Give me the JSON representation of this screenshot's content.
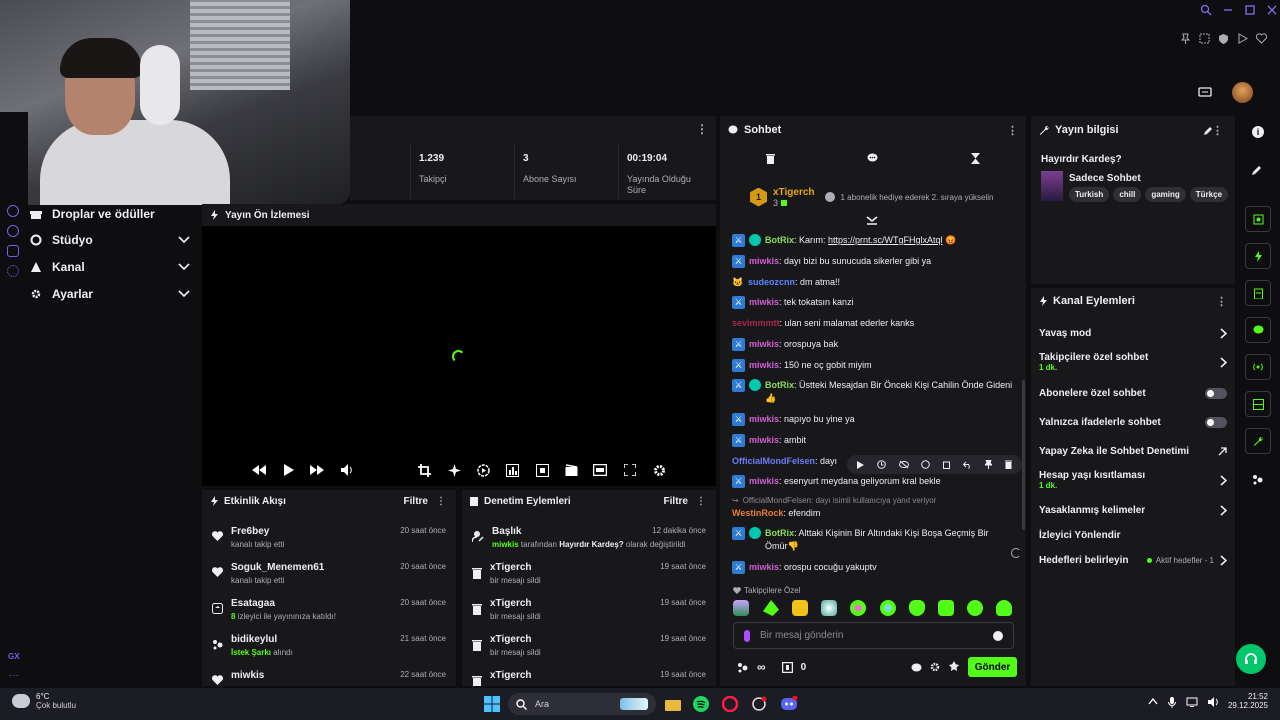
{
  "sidebar": {
    "items": [
      {
        "label": "Droplar ve ödüller",
        "icon": "gift-icon"
      },
      {
        "label": "Stüdyo",
        "icon": "camera-icon"
      },
      {
        "label": "Kanal",
        "icon": "channel-icon"
      },
      {
        "label": "Ayarlar",
        "icon": "gear-icon"
      }
    ],
    "bottom_label": "GX"
  },
  "stats": [
    {
      "value": "1.239",
      "label": "Takipçi"
    },
    {
      "value": "3",
      "label": "Abone Sayısı"
    },
    {
      "value": "00:19:04",
      "label": "Yayında Olduğu Süre"
    }
  ],
  "preview": {
    "title": "Yayın Ön İzlemesi"
  },
  "activity": {
    "title": "Etkinlik Akışı",
    "filter": "Filtre",
    "items": [
      {
        "name": "Fre6bey",
        "desc": "kanalı takip etti",
        "time": "20 saat önce",
        "icon": "heart-icon"
      },
      {
        "name": "Soguk_Menemen61",
        "desc": "kanalı takip etti",
        "time": "20 saat önce",
        "icon": "heart-icon"
      },
      {
        "name": "Esatagaa",
        "desc_prefix": "8",
        "desc": "izleyici ile yayınınıza katıldı!",
        "time": "20 saat önce",
        "icon": "raid-icon"
      },
      {
        "name": "bidikeylul",
        "desc_prefix": "İstek Şarkı",
        "desc": "alındı",
        "time": "21 saat önce",
        "icon": "points-icon"
      },
      {
        "name": "miwkis",
        "desc": "",
        "time": "22 saat önce",
        "icon": "heart-icon"
      }
    ]
  },
  "moderation": {
    "title": "Denetim Eylemleri",
    "filter": "Filtre",
    "items": [
      {
        "name": "Başlık",
        "user": "miwkis",
        "desc_a": "tarafından",
        "desc_b": "Hayırdır Kardeş?",
        "desc_c": "olarak değiştirildi",
        "time": "12 dakika önce",
        "icon": "edit-icon"
      },
      {
        "name": "xTigerch",
        "desc": "bir mesajı sildi",
        "time": "19 saat önce",
        "icon": "trash-icon"
      },
      {
        "name": "xTigerch",
        "desc": "bir mesajı sildi",
        "time": "19 saat önce",
        "icon": "trash-icon"
      },
      {
        "name": "xTigerch",
        "desc": "bir mesajı sildi",
        "time": "19 saat önce",
        "icon": "trash-icon"
      },
      {
        "name": "xTigerch",
        "desc": "",
        "time": "19 saat önce",
        "icon": "trash-icon"
      }
    ]
  },
  "chat": {
    "title": "Sohbet",
    "pinned": {
      "rank": "1",
      "user": "xTigerch",
      "count": "3",
      "text": "1 abonelik hediye ederek 2. sıraya yükselin"
    },
    "messages": [
      {
        "user": "BotRix",
        "cls": "u-bot",
        "text": "Karım: ",
        "link": "https://prnt.sc/WTgFHglxAtql",
        "badge": "mod-verified"
      },
      {
        "user": "miwkis",
        "cls": "u-miw",
        "text": "dayı bizi bu sunucuda sikerler gibi ya",
        "badge": "mod"
      },
      {
        "user": "sudeozcnn",
        "cls": "u-sude",
        "text": "dm atma!!",
        "badge": "cat"
      },
      {
        "user": "miwkis",
        "cls": "u-miw",
        "text": "tek tokatsın kanzi",
        "badge": "mod"
      },
      {
        "user": "sevimmmtt",
        "cls": "u-sev",
        "text": "ulan seni malamat ederler kanks",
        "badge": "none"
      },
      {
        "user": "miwkis",
        "cls": "u-miw",
        "text": "orospuya bak",
        "badge": "mod"
      },
      {
        "user": "miwkis",
        "cls": "u-miw",
        "text": "150 ne oç gobit miyim",
        "badge": "mod"
      },
      {
        "user": "BotRix",
        "cls": "u-bot",
        "text": "Üstteki Mesajdan Bir Önceki Kişi Cahilin Önde Gideni 👍",
        "badge": "mod-verified"
      },
      {
        "user": "miwkis",
        "cls": "u-miw",
        "text": "napıyo bu yine ya",
        "badge": "mod"
      },
      {
        "user": "miwkis",
        "cls": "u-miw",
        "text": "ambit",
        "badge": "mod"
      },
      {
        "user": "OfficialMondFelsen",
        "cls": "u-off",
        "text": "dayı",
        "badge": "none"
      },
      {
        "user": "miwkis",
        "cls": "u-miw",
        "text": "esenyurt meydana geliyorum kral bekle",
        "badge": "mod"
      },
      {
        "user": "WestinRock",
        "cls": "u-wes",
        "text": "efendim",
        "badge": "none",
        "reply": "OfficialMondFelsen: dayı isimli kullanıcıya yanıt veriyor"
      },
      {
        "user": "BotRix",
        "cls": "u-bot",
        "text": "Alttaki Kişinin Bir Altındaki Kişi Boşa Geçmiş Bir Ömür👎",
        "badge": "mod-verified"
      },
      {
        "user": "miwkis",
        "cls": "u-miw",
        "text": "orospu cocuğu yakuptv",
        "badge": "mod"
      }
    ],
    "emote_section": "Takipçilere Özel",
    "input_placeholder": "Bir mesaj gönderin",
    "points": "0",
    "send_label": "Gönder"
  },
  "stream_info": {
    "title": "Yayın bilgisi",
    "stream_title": "Hayırdır Kardeş?",
    "category": "Sadece Sohbet",
    "tags": [
      "Turkish",
      "chill",
      "gaming",
      "Türkçe"
    ]
  },
  "channel_actions": {
    "title": "Kanal Eylemleri",
    "items": [
      {
        "label": "Yavaş mod",
        "type": "chevron"
      },
      {
        "label": "Takipçilere özel sohbet",
        "sub": "1 dk.",
        "type": "chevron"
      },
      {
        "label": "Abonelere özel sohbet",
        "type": "toggle"
      },
      {
        "label": "Yalnızca ifadelerle sohbet",
        "type": "toggle"
      },
      {
        "label": "Yapay Zeka ile Sohbet Denetimi",
        "type": "external"
      },
      {
        "label": "Hesap yaşı kısıtlaması",
        "sub": "1 dk.",
        "type": "chevron"
      },
      {
        "label": "Yasaklanmış kelimeler",
        "type": "chevron"
      },
      {
        "label": "İzleyici Yönlendir",
        "type": "none"
      },
      {
        "label": "Hedefleri belirleyin",
        "extra": "Aktif hedefler - 1",
        "type": "chevron"
      }
    ]
  },
  "taskbar": {
    "weather_temp": "6°C",
    "weather_desc": "Çok bulutlu",
    "search": "Ara",
    "time": "21:52",
    "date": "29.12.2025"
  },
  "colors": {
    "accent": "#53fc18",
    "panel": "#18181b",
    "bg": "#0e0e10"
  }
}
